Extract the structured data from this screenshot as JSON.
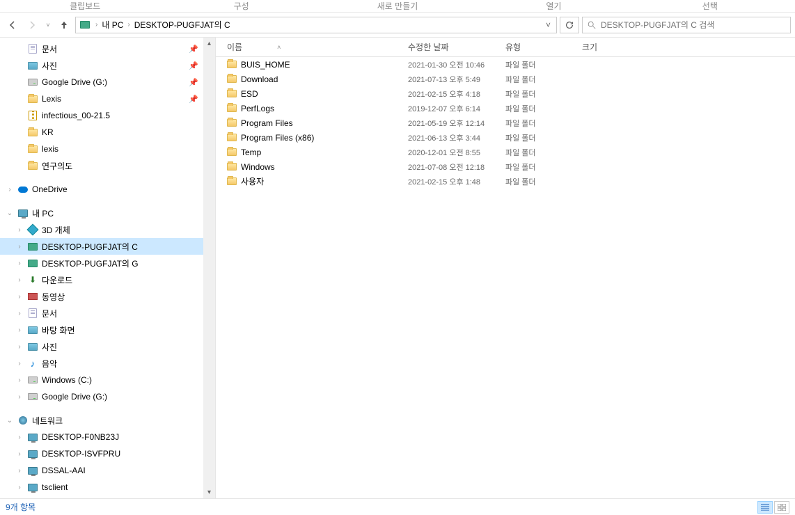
{
  "ribbon": {
    "tab1": "클립보드",
    "tab2": "구성",
    "tab3": "새로 만들기",
    "tab4": "열기",
    "tab5": "선택"
  },
  "breadcrumb": {
    "root_label": "내 PC",
    "current": "DESKTOP-PUGFJAT의 C"
  },
  "search": {
    "placeholder": "DESKTOP-PUGFJAT의 C 검색"
  },
  "sidebar": {
    "quick": [
      {
        "label": "문서",
        "icon": "doc",
        "pinned": true
      },
      {
        "label": "사진",
        "icon": "pic",
        "pinned": true
      },
      {
        "label": "Google Drive (G:)",
        "icon": "drive",
        "pinned": true
      },
      {
        "label": "Lexis",
        "icon": "folder",
        "pinned": true
      },
      {
        "label": "infectious_00-21.5",
        "icon": "zip",
        "pinned": false
      },
      {
        "label": "KR",
        "icon": "folder",
        "pinned": false
      },
      {
        "label": "lexis",
        "icon": "folder",
        "pinned": false
      },
      {
        "label": "연구의도",
        "icon": "folder",
        "pinned": false
      }
    ],
    "onedrive": "OneDrive",
    "thispc": "내 PC",
    "pc_items": [
      {
        "label": "3D 개체",
        "icon": "3d"
      },
      {
        "label": "DESKTOP-PUGFJAT의 C",
        "icon": "remote",
        "selected": true
      },
      {
        "label": "DESKTOP-PUGFJAT의 G",
        "icon": "remote"
      },
      {
        "label": "다운로드",
        "icon": "down"
      },
      {
        "label": "동영상",
        "icon": "video"
      },
      {
        "label": "문서",
        "icon": "doc"
      },
      {
        "label": "바탕 화면",
        "icon": "pic"
      },
      {
        "label": "사진",
        "icon": "pic"
      },
      {
        "label": "음악",
        "icon": "music"
      },
      {
        "label": "Windows (C:)",
        "icon": "drive"
      },
      {
        "label": "Google Drive (G:)",
        "icon": "drive"
      }
    ],
    "network": "네트워크",
    "net_items": [
      {
        "label": "DESKTOP-F0NB23J"
      },
      {
        "label": "DESKTOP-ISVFPRU"
      },
      {
        "label": "DSSAL-AAI"
      },
      {
        "label": "tsclient"
      }
    ]
  },
  "columns": {
    "name": "이름",
    "date": "수정한 날짜",
    "type": "유형",
    "size": "크기"
  },
  "files": [
    {
      "name": "BUIS_HOME",
      "date": "2021-01-30 오전 10:46",
      "type": "파일 폴더"
    },
    {
      "name": "Download",
      "date": "2021-07-13 오후 5:49",
      "type": "파일 폴더"
    },
    {
      "name": "ESD",
      "date": "2021-02-15 오후 4:18",
      "type": "파일 폴더"
    },
    {
      "name": "PerfLogs",
      "date": "2019-12-07 오후 6:14",
      "type": "파일 폴더"
    },
    {
      "name": "Program Files",
      "date": "2021-05-19 오후 12:14",
      "type": "파일 폴더"
    },
    {
      "name": "Program Files (x86)",
      "date": "2021-06-13 오후 3:44",
      "type": "파일 폴더"
    },
    {
      "name": "Temp",
      "date": "2020-12-01 오전 8:55",
      "type": "파일 폴더"
    },
    {
      "name": "Windows",
      "date": "2021-07-08 오전 12:18",
      "type": "파일 폴더"
    },
    {
      "name": "사용자",
      "date": "2021-02-15 오후 1:48",
      "type": "파일 폴더"
    }
  ],
  "status": {
    "text": "9개 항목"
  }
}
